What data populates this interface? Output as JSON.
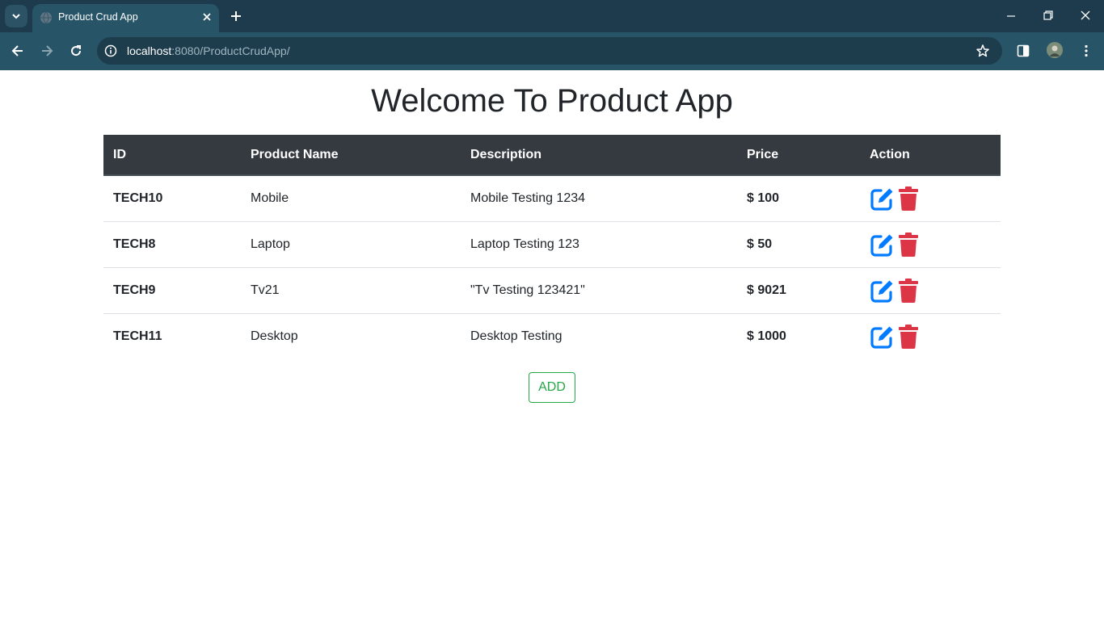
{
  "browser": {
    "tab_title": "Product Crud App",
    "url_host": "localhost",
    "url_rest": ":8080/ProductCrudApp/"
  },
  "page": {
    "title": "Welcome To Product App",
    "add_label": "ADD"
  },
  "table": {
    "headers": [
      "ID",
      "Product Name",
      "Description",
      "Price",
      "Action"
    ],
    "rows": [
      {
        "id": "TECH10",
        "name": "Mobile",
        "description": "Mobile Testing 1234",
        "price": "$ 100"
      },
      {
        "id": "TECH8",
        "name": "Laptop",
        "description": "Laptop Testing 123",
        "price": "$ 50"
      },
      {
        "id": "TECH9",
        "name": "Tv21",
        "description": "\"Tv Testing 123421\"",
        "price": "$ 9021"
      },
      {
        "id": "TECH11",
        "name": "Desktop",
        "description": "Desktop Testing",
        "price": "$ 1000"
      }
    ]
  },
  "icons": {
    "edit": "edit-icon",
    "delete": "trash-icon"
  },
  "colors": {
    "edit": "#007bff",
    "delete": "#dc3545",
    "add_button": "#28a745",
    "table_header": "#343a40"
  }
}
